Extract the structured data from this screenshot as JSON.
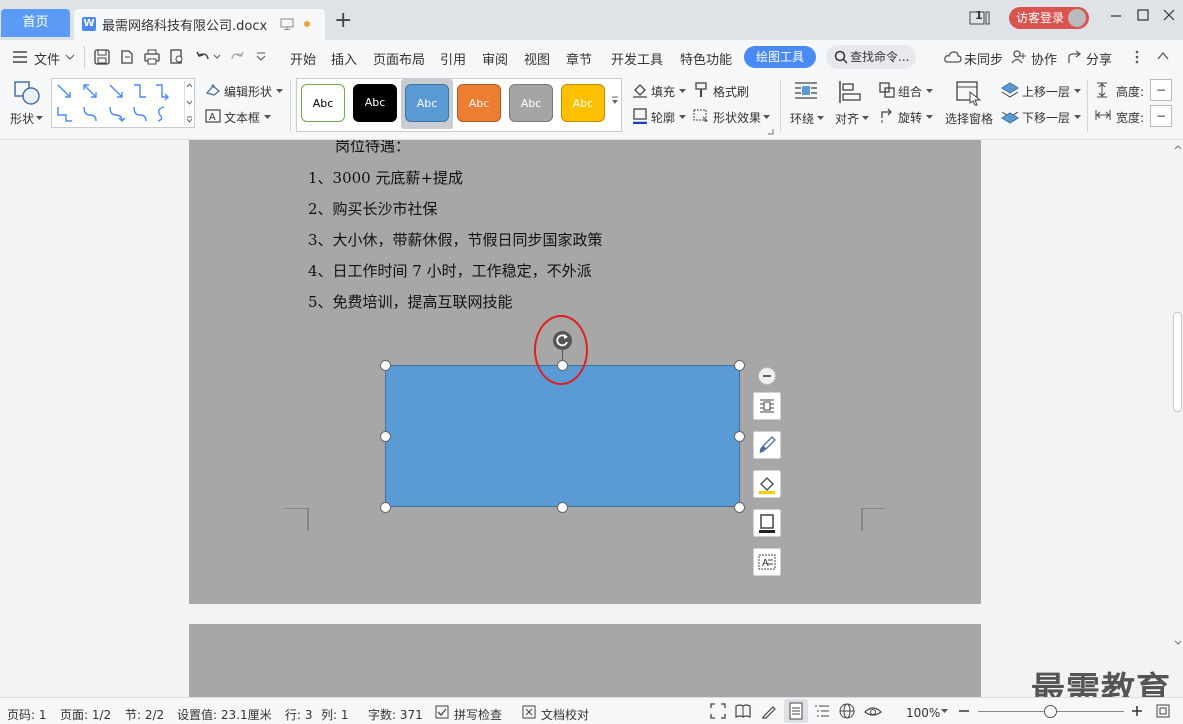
{
  "tabs": {
    "home": "首页",
    "doc_title": "最需网络科技有限公司.docx",
    "doc_icon_letter": "W",
    "new_tab": "+"
  },
  "account": {
    "login": "访客登录",
    "badge": "1"
  },
  "menu": {
    "file": "文件",
    "items": [
      "开始",
      "插入",
      "页面布局",
      "引用",
      "审阅",
      "视图",
      "章节",
      "开发工具",
      "特色功能"
    ],
    "active_tab": "绘图工具",
    "search_placeholder": "查找命令...",
    "sync": "未同步",
    "collab": "协作",
    "share": "分享"
  },
  "ribbon": {
    "shape": "形状",
    "edit_shape": "编辑形状",
    "text_box": "文本框",
    "style_sample": "Abc",
    "fill": "填充",
    "format_painter": "格式刷",
    "outline": "轮廓",
    "shape_effect": "形状效果",
    "wrap": "环绕",
    "align": "对齐",
    "group": "组合",
    "rotate": "旋转",
    "select_pane": "选择窗格",
    "bring_forward": "上移一层",
    "send_backward": "下移一层",
    "height": "高度:",
    "width": "宽度:",
    "style_colors": [
      "#ffffff",
      "#000000",
      "#5b9bd5",
      "#ed7d31",
      "#a5a5a5",
      "#ffc000"
    ],
    "accent": "#4a8af4"
  },
  "document": {
    "lines": [
      "岗位待遇：",
      "1、3000 元底薪+提成",
      "2、购买长沙市社保",
      "3、大小休，带薪休假，节假日同步国家政策",
      "4、日工作时间 7 小时，工作稳定，不外派",
      "5、免费培训，提高互联网技能"
    ],
    "shape_fill": "#5b9bd5",
    "highlight_color": "#e02020"
  },
  "status": {
    "page": "页码: 1",
    "pages": "页面: 1/2",
    "section": "节: 2/2",
    "setting": "设置值: 23.1厘米",
    "row": "行: 3",
    "col": "列: 1",
    "words": "字数: 371",
    "spell": "拼写检查",
    "proof": "文档校对",
    "zoom": "100%"
  },
  "watermark": "最需教育"
}
